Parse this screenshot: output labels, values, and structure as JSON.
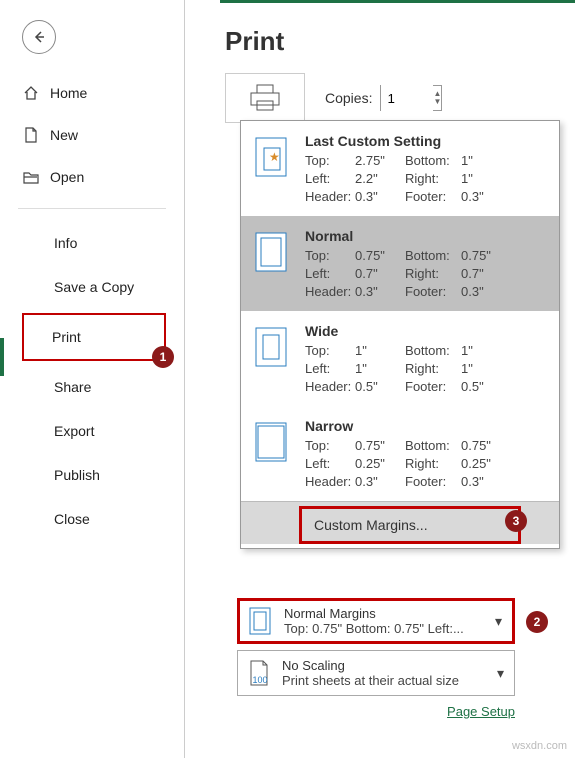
{
  "header": {
    "title": "Print"
  },
  "sidebar": {
    "top": [
      {
        "label": "Home"
      },
      {
        "label": "New"
      },
      {
        "label": "Open"
      }
    ],
    "menu": [
      {
        "label": "Info"
      },
      {
        "label": "Save a Copy"
      },
      {
        "label": "Print"
      },
      {
        "label": "Share"
      },
      {
        "label": "Export"
      },
      {
        "label": "Publish"
      },
      {
        "label": "Close"
      }
    ]
  },
  "copies": {
    "label": "Copies:",
    "value": "1"
  },
  "margins": {
    "options": [
      {
        "title": "Last Custom Setting",
        "top_l": "Top:",
        "top_v": "2.75\"",
        "bot_l": "Bottom:",
        "bot_v": "1\"",
        "left_l": "Left:",
        "left_v": "2.2\"",
        "right_l": "Right:",
        "right_v": "1\"",
        "head_l": "Header:",
        "head_v": "0.3\"",
        "foot_l": "Footer:",
        "foot_v": "0.3\""
      },
      {
        "title": "Normal",
        "top_l": "Top:",
        "top_v": "0.75\"",
        "bot_l": "Bottom:",
        "bot_v": "0.75\"",
        "left_l": "Left:",
        "left_v": "0.7\"",
        "right_l": "Right:",
        "right_v": "0.7\"",
        "head_l": "Header:",
        "head_v": "0.3\"",
        "foot_l": "Footer:",
        "foot_v": "0.3\""
      },
      {
        "title": "Wide",
        "top_l": "Top:",
        "top_v": "1\"",
        "bot_l": "Bottom:",
        "bot_v": "1\"",
        "left_l": "Left:",
        "left_v": "1\"",
        "right_l": "Right:",
        "right_v": "1\"",
        "head_l": "Header:",
        "head_v": "0.5\"",
        "foot_l": "Footer:",
        "foot_v": "0.5\""
      },
      {
        "title": "Narrow",
        "top_l": "Top:",
        "top_v": "0.75\"",
        "bot_l": "Bottom:",
        "bot_v": "0.75\"",
        "left_l": "Left:",
        "left_v": "0.25\"",
        "right_l": "Right:",
        "right_v": "0.25\"",
        "head_l": "Header:",
        "head_v": "0.3\"",
        "foot_l": "Footer:",
        "foot_v": "0.3\""
      }
    ],
    "custom": "Custom Margins..."
  },
  "current_margins": {
    "line1": "Normal Margins",
    "line2": "Top: 0.75\" Bottom: 0.75\" Left:..."
  },
  "scaling": {
    "line1": "No Scaling",
    "line2": "Print sheets at their actual size",
    "hundred": "100"
  },
  "page_setup": "Page Setup",
  "annotations": {
    "b1": "1",
    "b2": "2",
    "b3": "3"
  },
  "watermark": "wsxdn.com"
}
